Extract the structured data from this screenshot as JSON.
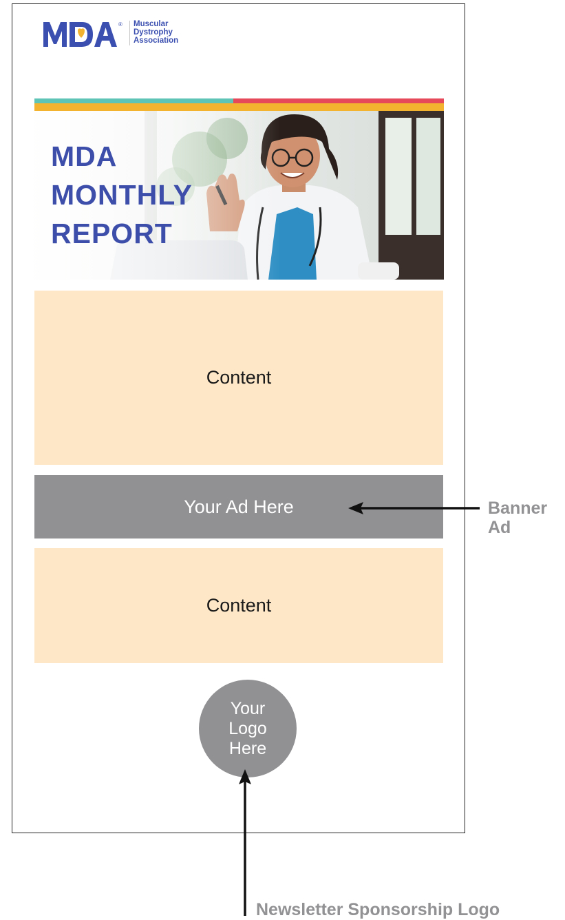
{
  "logo": {
    "mark_text": "MDA",
    "registered": "®",
    "subtitle_lines": [
      "Muscular",
      "Dystrophy",
      "Association"
    ]
  },
  "hero": {
    "title_lines": [
      "MDA",
      "MONTHLY",
      "REPORT"
    ]
  },
  "content_blocks": [
    {
      "label": "Content"
    },
    {
      "label": "Content"
    }
  ],
  "banner_ad": {
    "label": "Your Ad Here"
  },
  "sponsor_logo": {
    "lines": [
      "Your",
      "Logo",
      "Here"
    ]
  },
  "callouts": {
    "banner": [
      "Banner",
      "Ad"
    ],
    "sponsor": "Newsletter Sponsorship Logo"
  },
  "colors": {
    "brand_blue": "#3c4eaa",
    "teal": "#5ec4b6",
    "red": "#e64a5a",
    "yellow": "#f4b32f",
    "content_bg": "#fde7c6",
    "placeholder_gray": "#919194"
  }
}
